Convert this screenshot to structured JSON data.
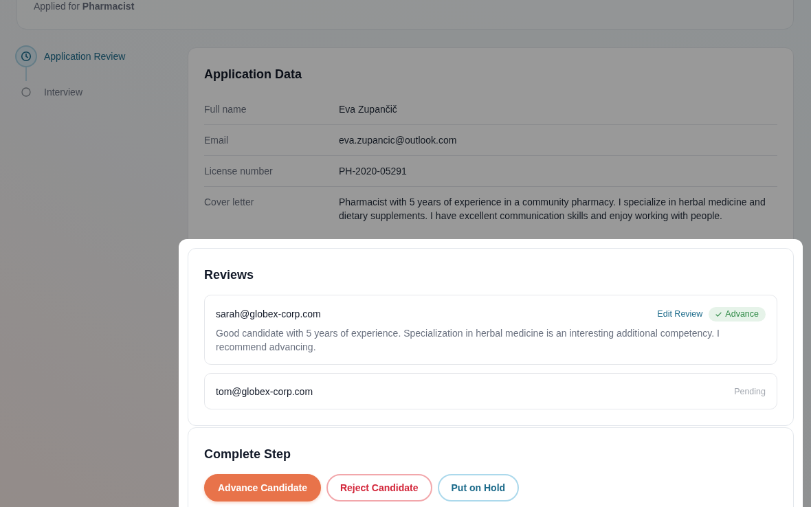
{
  "header": {
    "applied_for": "Applied for **Pharmacist**"
  },
  "steps": [
    {
      "label": "Application Review",
      "selected": true
    },
    {
      "label": "Interview",
      "selected": false
    }
  ],
  "sections": [
    {
      "kind": "fields",
      "title": "Application Data",
      "highlighted": false,
      "fields": [
        {
          "label": "Full name",
          "value": "Eva Zupančič"
        },
        {
          "label": "Email",
          "value": "eva.zupancic@outlook.com"
        },
        {
          "label": "License number",
          "value": "PH-2020-05291"
        },
        {
          "label": "Cover letter",
          "value": "Pharmacist with 5 years of experience in a community pharmacy. I specialize in herbal medicine and dietary supplements. I have excellent communication skills and enjoy working with people."
        }
      ]
    },
    {
      "kind": "reviews",
      "title": "Reviews",
      "highlighted": true,
      "reviews": [
        {
          "reviewer": "sarah@globex-corp.com",
          "action": "Edit Review",
          "verdict": "Advance",
          "comment": "Good candidate with 5 years of experience. Specialization in herbal medicine is an interesting additional competency. I recommend advancing."
        },
        {
          "reviewer": "tom@globex-corp.com",
          "status": "Pending"
        }
      ]
    },
    {
      "kind": "actions",
      "title": "Complete Step",
      "highlighted": true,
      "buttons": [
        {
          "label": "Advance Candidate",
          "kind": "primary"
        },
        {
          "label": "Reject Candidate",
          "kind": "danger"
        },
        {
          "label": "Put on Hold",
          "kind": "secondary"
        }
      ]
    }
  ]
}
